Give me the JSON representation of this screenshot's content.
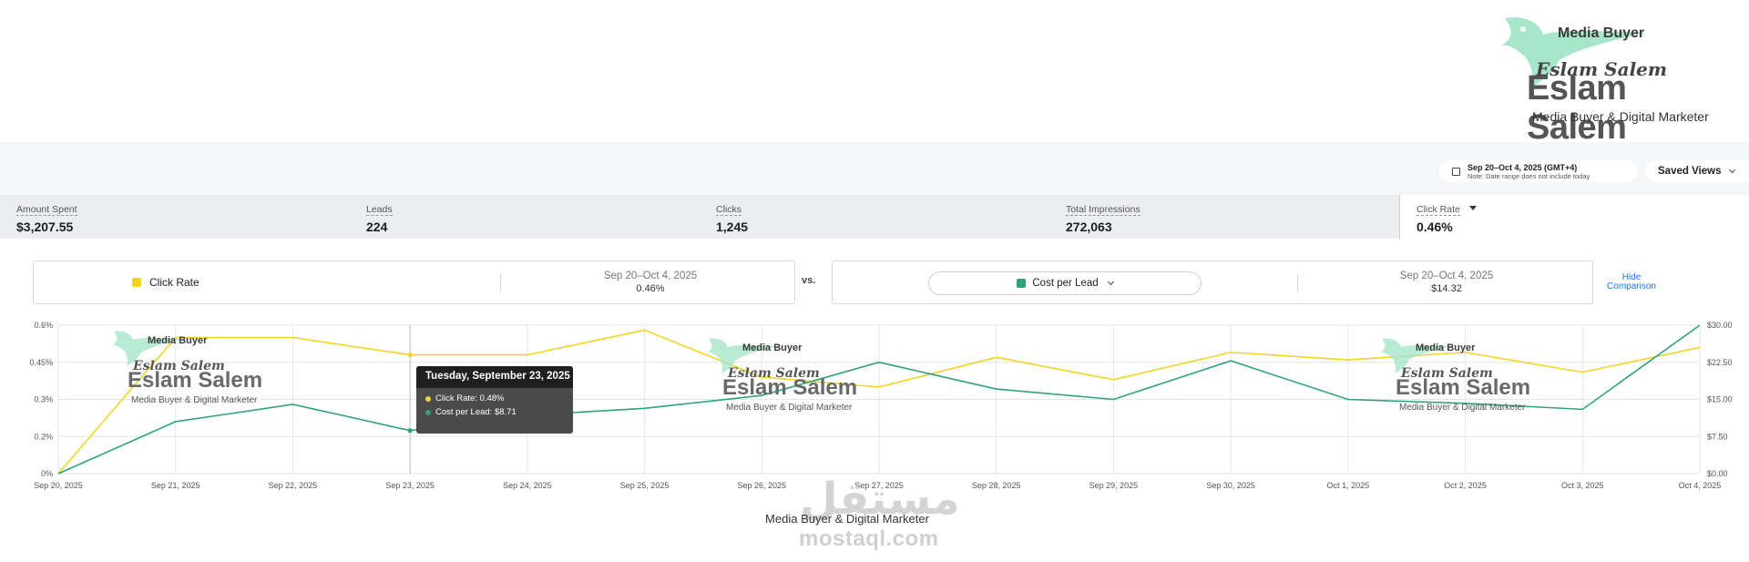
{
  "brand": {
    "top_line": "Media Buyer",
    "script_name": "Eslam Salem",
    "name": "Eslam Salem",
    "tagline": "Media Buyer & Digital Marketer"
  },
  "controls": {
    "date_range": "Sep 20–Oct 4, 2025 (GMT+4)",
    "date_note": "Note: Date range does not include today",
    "saved_views": "Saved Views"
  },
  "metrics": [
    {
      "label": "Amount Spent",
      "value": "$3,207.55"
    },
    {
      "label": "Leads",
      "value": "224"
    },
    {
      "label": "Clicks",
      "value": "1,245"
    },
    {
      "label": "Total Impressions",
      "value": "272,063"
    },
    {
      "label": "Click Rate",
      "value": "0.46%"
    }
  ],
  "comparison": {
    "left_metric": "Click Rate",
    "left_date": "Sep 20–Oct 4, 2025",
    "left_value": "0.46%",
    "vs": "vs.",
    "right_metric": "Cost per Lead",
    "right_date": "Sep 20–Oct 4, 2025",
    "right_value": "$14.32",
    "hide_line1": "Hide",
    "hide_line2": "Comparison"
  },
  "colors": {
    "click_rate": "#f2d524",
    "cost_per_lead": "#2ea37a",
    "grid": "#e6e6e6"
  },
  "chart_data": {
    "type": "line",
    "x": [
      "Sep 20, 2025",
      "Sep 21, 2025",
      "Sep 22, 2025",
      "Sep 23, 2025",
      "Sep 24, 2025",
      "Sep 25, 2025",
      "Sep 26, 2025",
      "Sep 27, 2025",
      "Sep 28, 2025",
      "Sep 29, 2025",
      "Sep 30, 2025",
      "Oct 1, 2025",
      "Oct 2, 2025",
      "Oct 3, 2025",
      "Oct 4, 2025"
    ],
    "series": [
      {
        "name": "Click Rate",
        "axis": "left",
        "unit": "%",
        "values": [
          0,
          0.55,
          0.55,
          0.48,
          0.48,
          0.58,
          0.39,
          0.35,
          0.47,
          0.38,
          0.49,
          0.46,
          0.49,
          0.41,
          0.51
        ]
      },
      {
        "name": "Cost per Lead",
        "axis": "right",
        "unit": "$",
        "values": [
          0,
          10.5,
          14.0,
          8.71,
          11.8,
          13.2,
          15.8,
          22.5,
          17.1,
          15.0,
          22.8,
          15.0,
          14.2,
          13.0,
          30.0
        ]
      }
    ],
    "y_left": {
      "ticks": [
        0,
        0.15,
        0.3,
        0.45,
        0.6
      ],
      "tick_labels": [
        "0%",
        "0.2%",
        "0.3%",
        "0.45%",
        "0.6%"
      ],
      "range": [
        0,
        0.6
      ]
    },
    "y_right": {
      "ticks": [
        0,
        7.5,
        15,
        22.5,
        30
      ],
      "tick_labels": [
        "$0.00",
        "$7.50",
        "$15.00",
        "$22.50",
        "$30.00"
      ],
      "range": [
        0,
        30
      ]
    },
    "grid": true,
    "highlight_index": 3
  },
  "tooltip": {
    "date": "Tuesday, September 23, 2025",
    "row1": "Click Rate: 0.48%",
    "row2": "Cost per Lead: $8.71"
  },
  "watermark": {
    "top_line": "Media Buyer",
    "script_name": "Eslam Salem",
    "name": "Eslam Salem",
    "tagline": "Media Buyer & Digital Marketer"
  },
  "footer": {
    "tagline": "Media Buyer & Digital Marketer",
    "arabic": "مستقل",
    "site": "mostaql.com"
  }
}
